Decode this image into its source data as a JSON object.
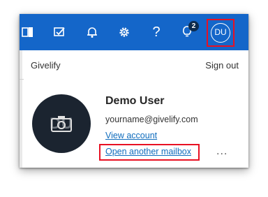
{
  "colors": {
    "topbar": "#1466c9",
    "highlight": "#e81123",
    "link": "#0f6cbd",
    "avatar_bg": "#1b2430"
  },
  "topbar": {
    "icons": [
      "apps-icon",
      "todo-icon",
      "bell-icon",
      "gear-icon",
      "help-icon",
      "lightbulb-icon"
    ],
    "help_glyph": "?",
    "whats_new_badge": "2",
    "profile_initials": "DU"
  },
  "panel": {
    "org_name": "Givelify",
    "sign_out": "Sign out",
    "user_name": "Demo User",
    "email": "yourname@givelify.com",
    "view_account": "View account",
    "open_mailbox": "Open another mailbox",
    "more": "..."
  }
}
